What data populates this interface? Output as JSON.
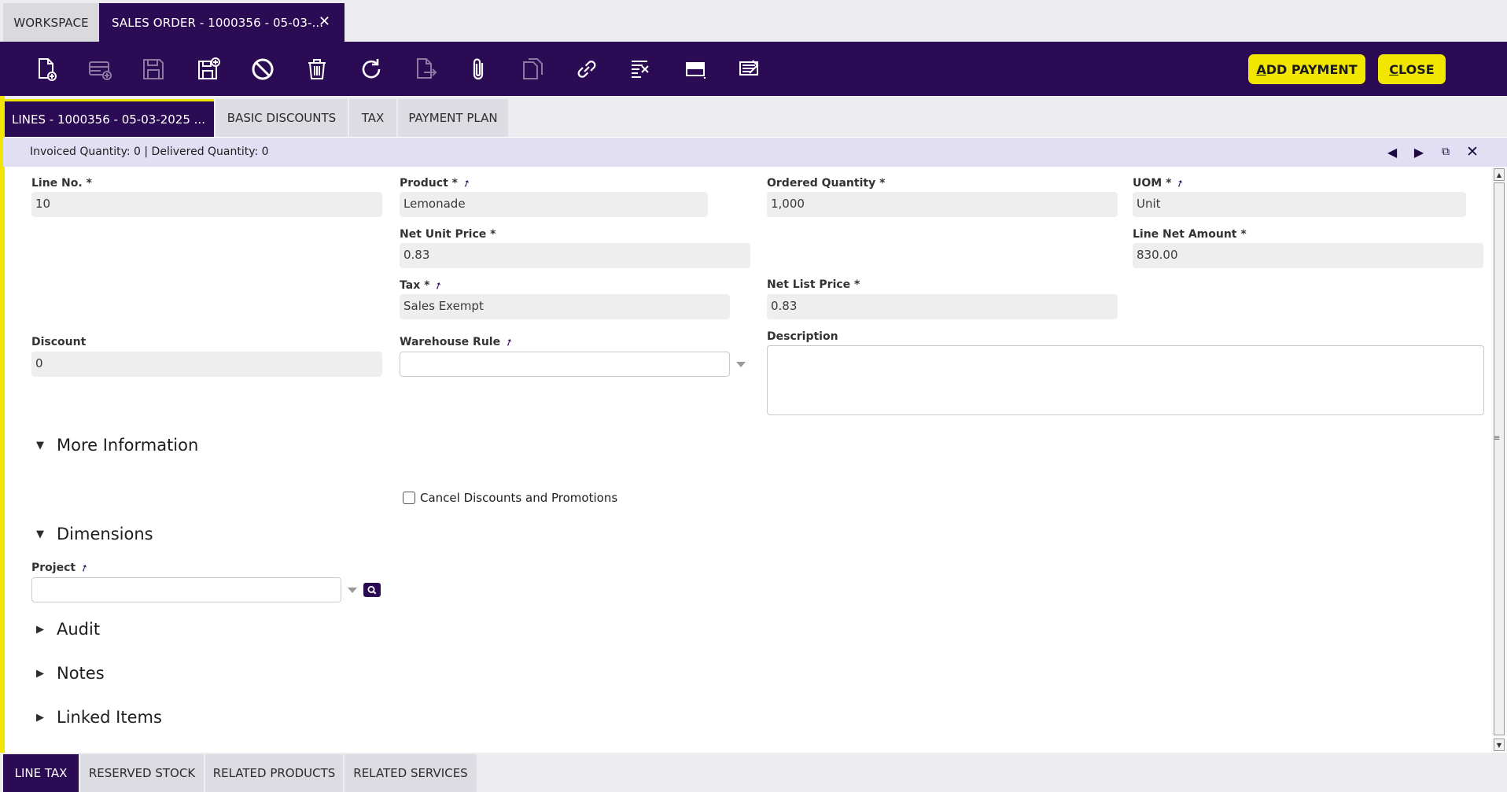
{
  "top_tabs": {
    "workspace": "WORKSPACE",
    "active": "SALES ORDER - 1000356 - 05-03-...",
    "close_symbol": "✕"
  },
  "toolbar": {
    "icons": [
      "new-document-icon",
      "new-row-icon",
      "save-icon",
      "save-and-close-icon",
      "undo-icon",
      "delete-icon",
      "refresh-icon",
      "export-icon",
      "attachment-icon",
      "copy-record-icon",
      "link-icon",
      "filter-icon",
      "grid-view-icon",
      "notes-icon"
    ],
    "add_payment_underlined": "A",
    "add_payment_rest": "DD PAYMENT",
    "close_underlined": "C",
    "close_rest": "LOSE"
  },
  "sub_tabs": [
    "LINES - 1000356 - 05-03-2025 ...",
    "BASIC DISCOUNTS",
    "TAX",
    "PAYMENT PLAN"
  ],
  "info_bar": {
    "text": "Invoiced Quantity: 0  |  Delivered Quantity: 0"
  },
  "form": {
    "line_no": {
      "label": "Line No. *",
      "value": "10"
    },
    "product": {
      "label": "Product *",
      "value": "Lemonade"
    },
    "ordered_quantity": {
      "label": "Ordered Quantity *",
      "value": "1,000"
    },
    "uom": {
      "label": "UOM *",
      "value": "Unit"
    },
    "net_unit_price": {
      "label": "Net Unit Price *",
      "value": "0.83"
    },
    "line_net_amount": {
      "label": "Line Net Amount *",
      "value": "830.00"
    },
    "tax": {
      "label": "Tax *",
      "value": "Sales Exempt"
    },
    "net_list_price": {
      "label": "Net List Price *",
      "value": "0.83"
    },
    "discount": {
      "label": "Discount",
      "value": "0"
    },
    "warehouse_rule": {
      "label": "Warehouse Rule",
      "value": ""
    },
    "description": {
      "label": "Description",
      "value": ""
    },
    "cancel_discounts": {
      "label": "Cancel Discounts and Promotions",
      "checked": false
    },
    "project": {
      "label": "Project",
      "value": ""
    }
  },
  "sections": {
    "more_information": "More Information",
    "dimensions": "Dimensions",
    "audit": "Audit",
    "notes": "Notes",
    "linked_items": "Linked Items"
  },
  "bottom_tabs": [
    "LINE TAX",
    "RESERVED STOCK",
    "RELATED PRODUCTS",
    "RELATED SERVICES"
  ],
  "colors": {
    "brand_purple": "#2c0b55",
    "accent_yellow": "#f2e600",
    "info_bar": "#e2dff5"
  }
}
